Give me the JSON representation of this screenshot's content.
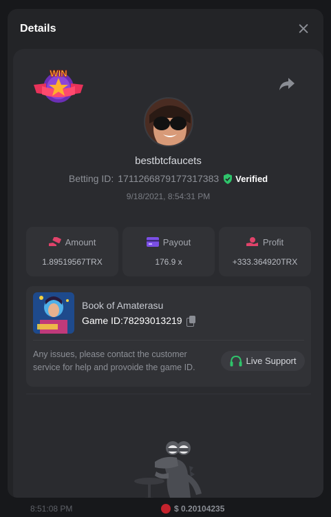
{
  "modal": {
    "title": "Details"
  },
  "header": {
    "badge": "WIN"
  },
  "user": {
    "name": "bestbtcfaucets",
    "betting_id_label": "Betting ID:",
    "betting_id": "171126687917731738​3",
    "verified": "Verified",
    "date": "9/18/2021, 8:54:31 PM"
  },
  "stats": [
    {
      "label": "Amount",
      "value": "1.89519567TRX",
      "icon": "money-hand-icon",
      "color": "#e0436a"
    },
    {
      "label": "Payout",
      "value": "176.9 x",
      "icon": "card-icon",
      "color": "#7b4fe6"
    },
    {
      "label": "Profit",
      "value": "+333.364920TRX",
      "icon": "coins-hand-icon",
      "color": "#e0436a"
    }
  ],
  "game": {
    "name": "Book of Amaterasu",
    "id_label": "Game ID:",
    "id": "78293013219",
    "notice": "Any issues, please contact the customer service for help and provoide the game ID.",
    "support": "Live Support"
  },
  "background": {
    "time": "8:51:08 PM",
    "amount": "$ 0.20104235"
  },
  "colors": {
    "accent_green": "#2fc46b",
    "card": "#2a2b2f",
    "modal": "#232427"
  }
}
